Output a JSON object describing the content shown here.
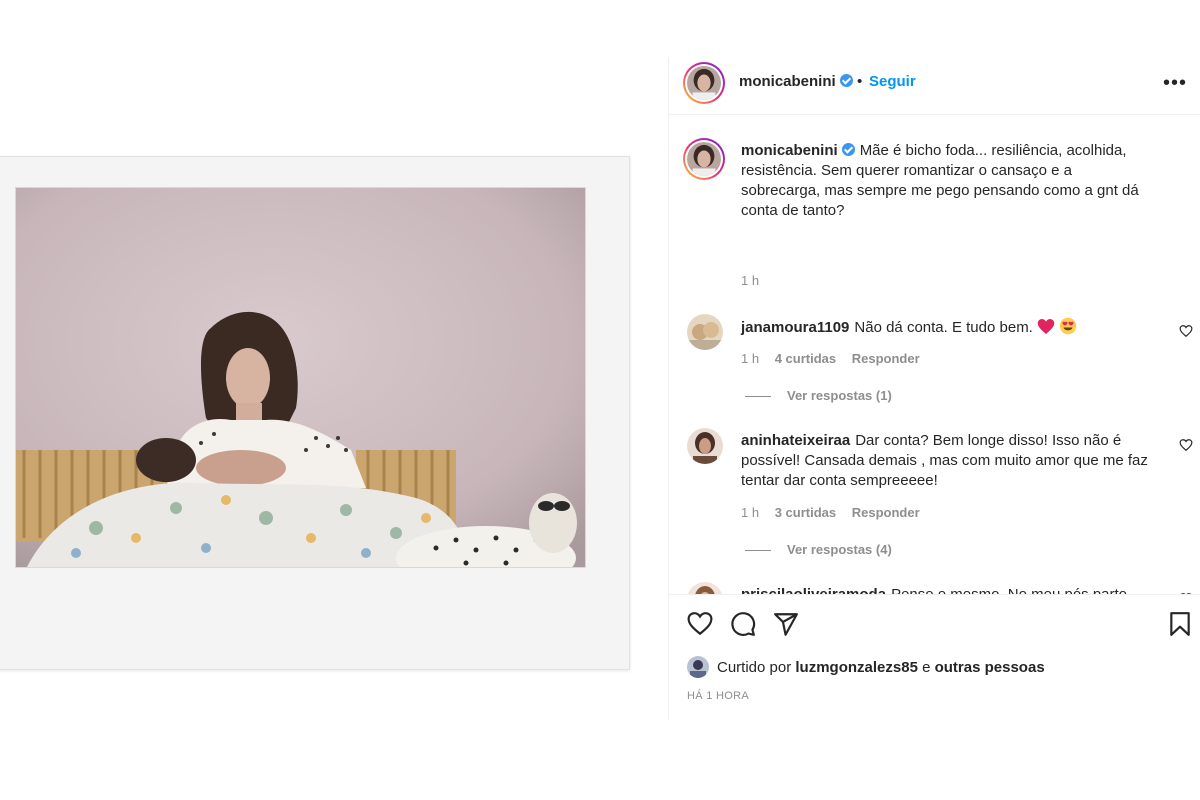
{
  "post": {
    "author": "monicabenini",
    "separator": "•",
    "follow_label": "Seguir",
    "more_label": "•••"
  },
  "caption": {
    "username": "monicabenini",
    "text": "Mãe é bicho foda... resiliência, acolhida, resistência. Sem querer romantizar o cansaço e a sobrecarga, mas sempre me pego pensando como a gnt dá conta de tanto?",
    "time": "1 h"
  },
  "comments": [
    {
      "username": "janamoura1109",
      "text": "Não dá conta. E tudo bem.",
      "emojis": [
        "heart",
        "heart-eyes"
      ],
      "time": "1 h",
      "likes": "4 curtidas",
      "reply_label": "Responder",
      "view_replies": "Ver respostas (1)"
    },
    {
      "username": "aninhateixeiraa",
      "text": "Dar conta? Bem longe disso! Isso não é possível! Cansada demais , mas com muito amor que me faz tentar dar conta sempreeeee!",
      "time": "1 h",
      "likes": "3 curtidas",
      "reply_label": "Responder",
      "view_replies": "Ver respostas (4)"
    },
    {
      "username": "priscilaoliveiramoda",
      "text": "Penso o mesmo. No meu pós parto ficava pensando como era possível virar noites, exausta, mas sempre pronta para acolher e atender meu filho e sem nunca sequer"
    }
  ],
  "likes_line": {
    "prefix": "Curtido por",
    "user": "luzmgonzalezs85",
    "conj": "e",
    "others": "outras pessoas"
  },
  "timestamp": "HÁ 1 HORA",
  "icons": {
    "like": "heart-icon",
    "comment": "comment-icon",
    "share": "share-icon",
    "save": "bookmark-icon",
    "more": "more-icon",
    "verified": "verified-badge-icon"
  },
  "colors": {
    "accent": "#0095f6",
    "verified": "#3897f0",
    "muted": "#8e8e8e",
    "text": "#262626"
  }
}
